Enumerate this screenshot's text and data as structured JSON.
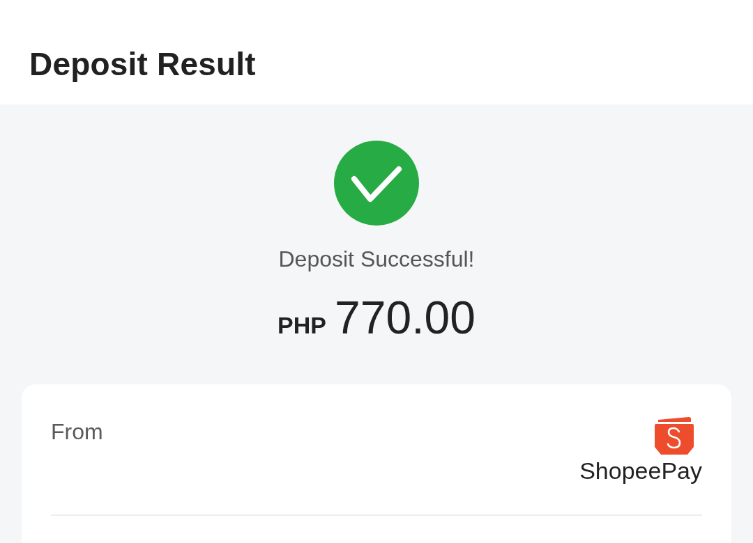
{
  "header": {
    "title": "Deposit Result"
  },
  "result": {
    "successful": true,
    "message": "Deposit Successful!",
    "currency": "PHP",
    "amount": "770.00"
  },
  "details": [
    {
      "kind": "wallet",
      "label": "From",
      "value": "ShopeePay"
    }
  ]
}
